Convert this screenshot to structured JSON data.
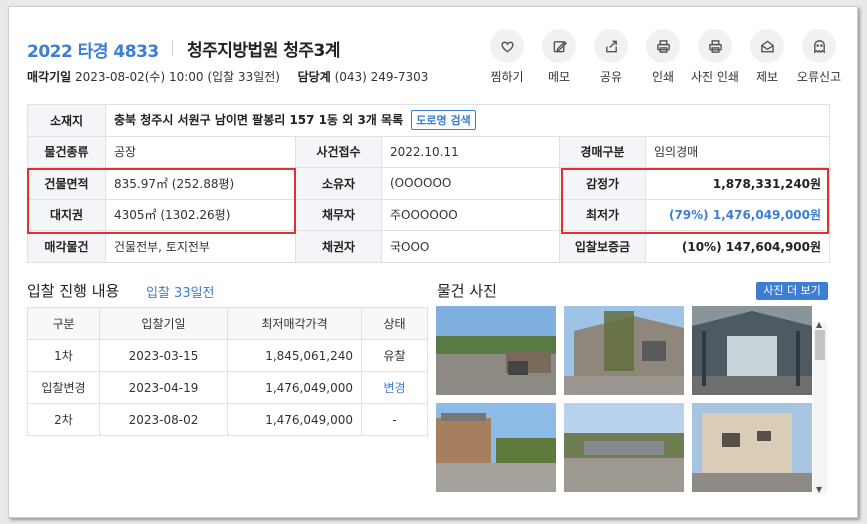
{
  "header": {
    "case_number": "2022 타경 4833",
    "court": "청주지방법원 청주3계",
    "sale_date_label": "매각기일",
    "sale_date_value": "2023-08-02(수) 10:00 (입찰 33일전)",
    "dept_label": "담당계",
    "dept_phone": "(043) 249-7303"
  },
  "actions": [
    {
      "label": "찜하기",
      "icon": "heart-icon"
    },
    {
      "label": "메모",
      "icon": "memo-icon"
    },
    {
      "label": "공유",
      "icon": "share-icon"
    },
    {
      "label": "인쇄",
      "icon": "print-icon"
    },
    {
      "label": "사진 인쇄",
      "icon": "print-icon"
    },
    {
      "label": "제보",
      "icon": "report-icon"
    },
    {
      "label": "오류신고",
      "icon": "error-report-icon"
    }
  ],
  "info": {
    "location_label": "소재지",
    "location_value": "충북 청주시 서원구 남이면 팔봉리 157 1동 외 3개 목록",
    "road_search": "도로명 검색",
    "type_label": "물건종류",
    "type_value": "공장",
    "received_label": "사건접수",
    "received_value": "2022.10.11",
    "auction_type_label": "경매구분",
    "auction_type_value": "임의경매",
    "building_area_label": "건물면적",
    "building_area_value": "835.97㎡ (252.88평)",
    "owner_label": "소유자",
    "owner_value": "(OOOOOO",
    "appraisal_label": "감정가",
    "appraisal_value": "1,878,331,240원",
    "land_label": "대지권",
    "land_value": "4305㎡ (1302.26평)",
    "debtor_label": "채무자",
    "debtor_value": "주OOOOOO",
    "min_price_label": "최저가",
    "min_price_value": "(79%) 1,476,049,000원",
    "sale_item_label": "매각물건",
    "sale_item_value": "건물전부, 토지전부",
    "creditor_label": "채권자",
    "creditor_value": "국OOO",
    "deposit_label": "입찰보증금",
    "deposit_value": "(10%) 147,604,900원"
  },
  "bid_history": {
    "title": "입찰 진행 내용",
    "days_left": "입찰 33일전",
    "columns": [
      "구분",
      "입찰기일",
      "최저매각가격",
      "상태"
    ],
    "rows": [
      [
        "1차",
        "2023-03-15",
        "1,845,061,240",
        "유찰"
      ],
      [
        "입찰변경",
        "2023-04-19",
        "1,476,049,000",
        "변경"
      ],
      [
        "2차",
        "2023-08-02",
        "1,476,049,000",
        "-"
      ]
    ]
  },
  "photos": {
    "title": "물건 사진",
    "more_button": "사진 더 보기"
  },
  "colors": {
    "accent": "#3b7ed3",
    "highlight_box": "#e03030"
  }
}
